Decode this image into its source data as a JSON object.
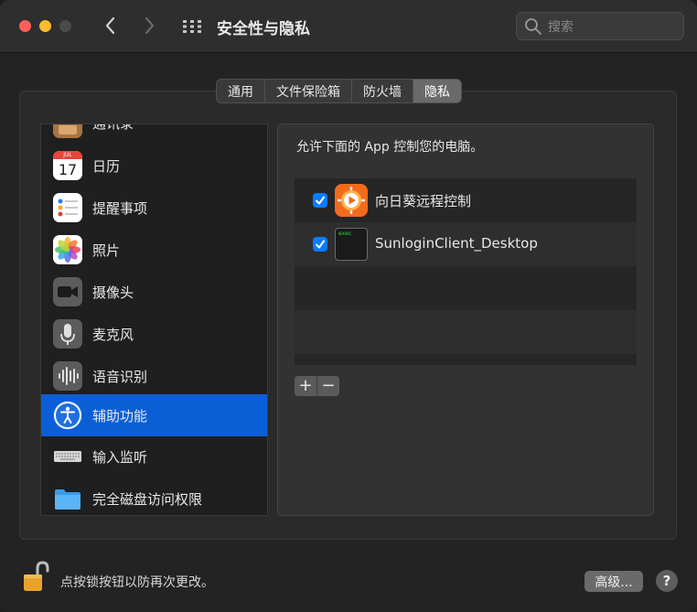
{
  "window": {
    "title": "安全性与隐私"
  },
  "search": {
    "placeholder": "搜索"
  },
  "tabs": [
    {
      "label": "通用",
      "active": false
    },
    {
      "label": "文件保险箱",
      "active": false
    },
    {
      "label": "防火墙",
      "active": false
    },
    {
      "label": "隐私",
      "active": true
    }
  ],
  "sidebar": {
    "items": [
      {
        "label": "通讯录",
        "icon": "contacts-icon"
      },
      {
        "label": "日历",
        "icon": "calendar-icon",
        "calendar_month": "JUL",
        "calendar_day": "17"
      },
      {
        "label": "提醒事项",
        "icon": "reminders-icon"
      },
      {
        "label": "照片",
        "icon": "photos-icon"
      },
      {
        "label": "摄像头",
        "icon": "camera-icon"
      },
      {
        "label": "麦克风",
        "icon": "microphone-icon"
      },
      {
        "label": "语音识别",
        "icon": "speech-recognition-icon"
      },
      {
        "label": "辅助功能",
        "icon": "accessibility-icon",
        "selected": true
      },
      {
        "label": "输入监听",
        "icon": "keyboard-icon"
      },
      {
        "label": "完全磁盘访问权限",
        "icon": "folder-icon"
      }
    ]
  },
  "panel": {
    "prompt": "允许下面的 App 控制您的电脑。",
    "apps": [
      {
        "label": "向日葵远程控制",
        "checked": true,
        "icon": "sunlogin-icon"
      },
      {
        "label": "SunloginClient_Desktop",
        "checked": true,
        "icon": "terminal-icon",
        "icon_text": "exec"
      }
    ],
    "add_label": "+",
    "remove_label": "−"
  },
  "footer": {
    "lock_text": "点按锁按钮以防再次更改。",
    "advanced_label": "高级...",
    "help_label": "?"
  },
  "colors": {
    "accent": "#0a5fd6",
    "checkbox": "#0a7cff"
  }
}
